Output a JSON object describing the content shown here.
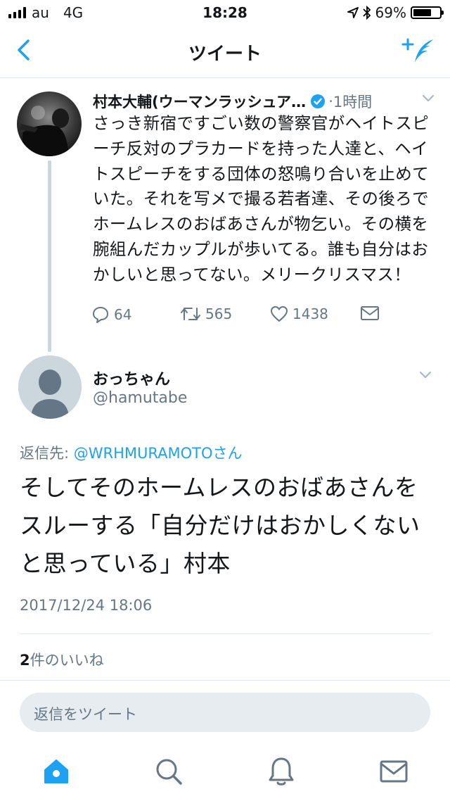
{
  "status_bar": {
    "carrier": "au",
    "network": "4G",
    "time": "18:28",
    "battery": "69%",
    "battery_level": 0.69
  },
  "nav": {
    "title": "ツイート",
    "back_icon": "chevron-left-icon",
    "compose_icon": "compose-tweet-icon"
  },
  "tweet1": {
    "author": "村本大輔(ウーマンラッシュア…",
    "time": "1時間",
    "text": "さっき新宿ですごい数の警察官がヘイトスピーチ反対のプラカードを持った人達と、ヘイトスピーチをする団体の怒鳴り合いを止めていた。それを写メで撮る若者達、その後ろでホームレスのおばあさんが物乞い。その横を腕組んだカップルが歩いてる。誰も自分はおかしいと思ってない。メリークリスマス！",
    "replies": "64",
    "retweets": "565",
    "likes": "1438"
  },
  "tweet2": {
    "author": "おっちゃん",
    "handle": "@hamutabe",
    "reply_prefix": "返信先: ",
    "reply_to": "@WRHMURAMOTOさん",
    "text": "そしてそのホームレスのおばあさんをスルーする「自分だけはおかしくないと思っている」村本",
    "timestamp": "2017/12/24 18:06",
    "likes_count": "2",
    "likes_label": "件のいいね"
  },
  "reply_box": {
    "placeholder": "返信をツイート"
  },
  "colors": {
    "accent": "#1da1f2",
    "muted": "#657786",
    "text": "#14171a"
  }
}
